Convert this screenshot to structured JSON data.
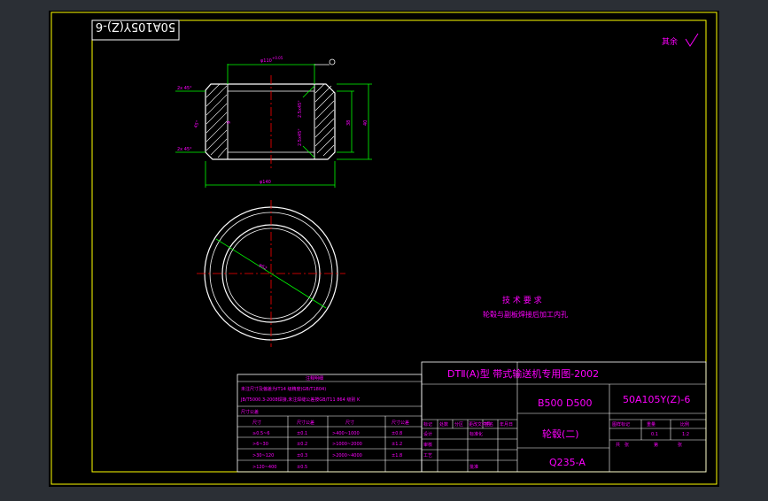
{
  "drawing_code_mirrored": "50A105Y(Z)-6",
  "roughness_note": "其余",
  "dimensions": {
    "top_diameter": "φ110",
    "top_diameter_tol": "+0.05",
    "chamfer_top": "2x 45°",
    "chamfer_bottom": "2x 45°",
    "angle_left": "45°",
    "inner_label": "9",
    "right_angle_top": "2.5x45°",
    "right_angle_bottom": "2.5x45°",
    "height_inner": "38",
    "height_outer": "40",
    "bottom_diameter": "φ140",
    "circle_diameter": "φ62"
  },
  "tech_req": {
    "title": "技 术 要 求",
    "line1": "轮毂与副板焊接后加工内孔"
  },
  "notes_table": {
    "title": "注释明细",
    "rows": [
      "未注尺寸及偏差为IT14 级精度(GB/T1804)",
      "JB/T5000.3-2008焊接,未注焊缝公差按GB/T11 864 级别 K",
      "尺寸公差"
    ],
    "headers": [
      "尺寸",
      "尺寸公差",
      "尺寸",
      "尺寸公差"
    ],
    "data": [
      [
        "≥0.5~6",
        "±0.1",
        ">400~1000",
        "±0.8"
      ],
      [
        ">6~30",
        "±0.2",
        ">1000~2000",
        "±1.2"
      ],
      [
        ">30~120",
        "±0.3",
        ">2000~4000",
        "±1.8"
      ],
      [
        ">120~400",
        "±0.5",
        "",
        ""
      ]
    ]
  },
  "title_block": {
    "main_title": "DTⅡ(A)型  带式输送机专用图-2002",
    "spec": "B500 D500",
    "drawing_no": "50A105Y(Z)-6",
    "part_name": "轮毂(二)",
    "material": "Q235-A",
    "stage_label": "图样标记",
    "weight_label": "重量",
    "scale_label": "比例",
    "scale_value": "1:2",
    "weight_value": "0.1",
    "sheet_label": "共",
    "sheet_of": "第",
    "sheet_unit": "张",
    "sign_rows": [
      "标记",
      "处数",
      "分区",
      "更改文件号",
      "签名",
      "年月日"
    ],
    "role_design": "设计",
    "role_std": "标准化",
    "role_check": "审核",
    "role_process": "工艺",
    "role_approve": "批准"
  },
  "colors": {
    "background": "#000000",
    "border": "#ffff00",
    "geometry": "#ffffff",
    "dimension": "#00ff00",
    "centerline": "#ff0000",
    "text": "#ff00ff",
    "hatch": "#ffffff",
    "frame_outer": "#2b2f35"
  }
}
